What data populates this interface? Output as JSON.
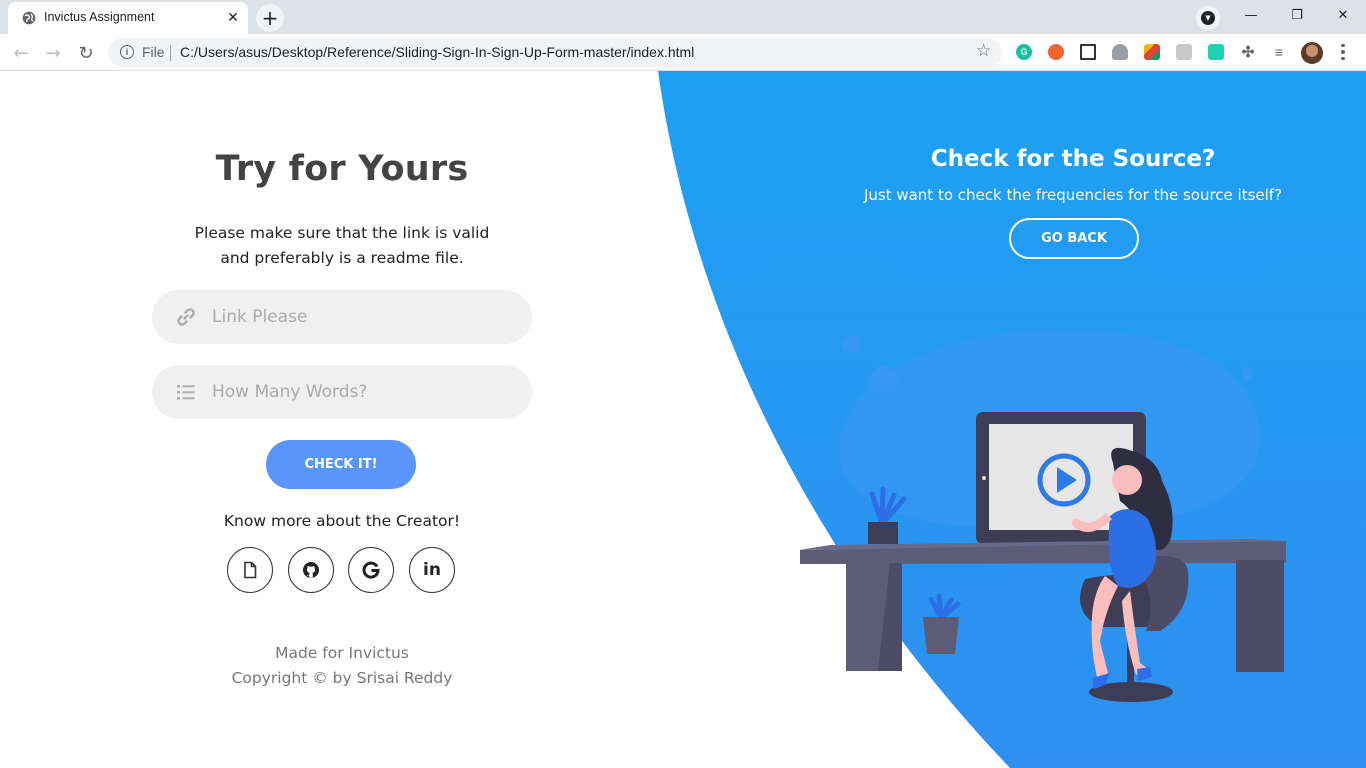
{
  "browser": {
    "tab_title": "Invictus Assignment",
    "tab_close": "✕",
    "new_tab": "+",
    "window_minimize": "—",
    "window_restore": "❐",
    "window_close": "✕",
    "omnibox_scheme": "File",
    "omnibox_url": "C:/Users/asus/Desktop/Reference/Sliding-Sign-In-Sign-Up-Form-master/index.html",
    "bookmark_icon": "☆",
    "back_icon": "←",
    "forward_icon": "→",
    "reload_icon": "↻"
  },
  "page": {
    "heading": "Try for Yours",
    "description_line1": "Please make sure that the link is valid",
    "description_line2": "and preferably is a readme file.",
    "link_placeholder": "Link Please",
    "words_placeholder": "How Many Words?",
    "check_button": "CHECK IT!",
    "social_text": "Know more about the Creator!",
    "social_icons": [
      "file-icon",
      "github-icon",
      "google-icon",
      "linkedin-icon"
    ],
    "linkedin_glyph": "in",
    "footer_line1": "Made for Invictus",
    "footer_line2": "Copyright © by Srisai Reddy"
  },
  "panel": {
    "title": "Check for the Source?",
    "description": "Just want to check the frequencies for the source itself?",
    "go_back": "GO BACK"
  },
  "colors": {
    "accent": "#5995fd",
    "panel_blue_top": "#1da1f2",
    "panel_blue_bottom": "#2f8ff0",
    "heading": "#444444",
    "field_bg": "#f0f0f0"
  }
}
